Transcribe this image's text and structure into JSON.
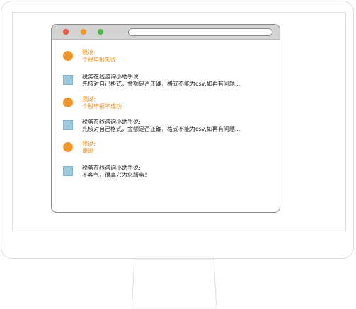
{
  "colors": {
    "user_accent": "#f08a12",
    "bot_avatar": "#9ccbe0",
    "window_red": "#e8553c",
    "window_orange": "#f39a1e",
    "window_green": "#52b548"
  },
  "messages": [
    {
      "role": "user",
      "speaker": "我说:",
      "text": "个税申报失败"
    },
    {
      "role": "bot",
      "speaker": "税务在线咨询小助手说:",
      "text": "先核对自己格式，金额是否正确，格式不能为csv,如再有问题..."
    },
    {
      "role": "user",
      "speaker": "我说:",
      "text": "个税申报不成功"
    },
    {
      "role": "bot",
      "speaker": "税务在线咨询小助手说:",
      "text": "先核对自己格式，金额是否正确，格式不能为csv,如再有问题..."
    },
    {
      "role": "user",
      "speaker": "我说:",
      "text": "谢谢"
    },
    {
      "role": "bot",
      "speaker": "税务在线咨询小助手说:",
      "text": "不客气，很高兴为您服务！"
    }
  ]
}
